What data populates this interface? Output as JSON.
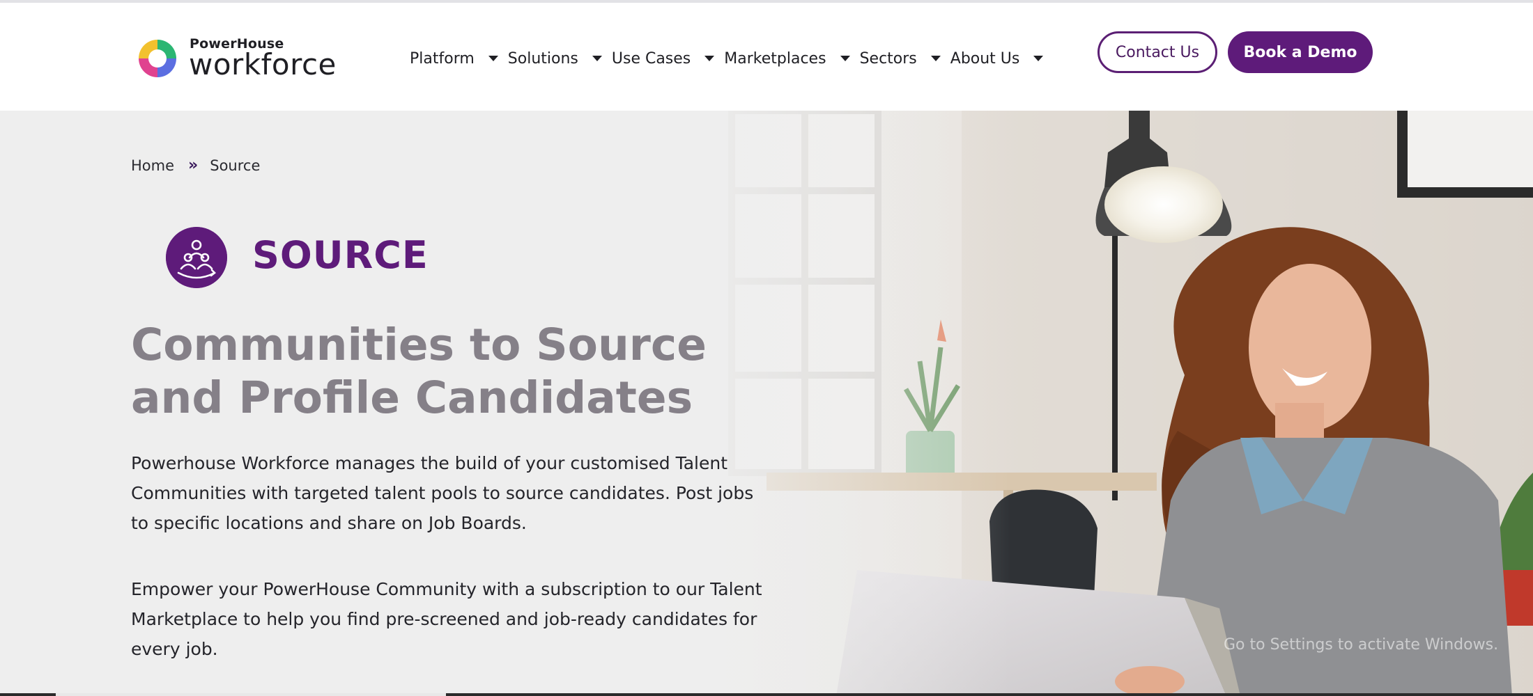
{
  "header": {
    "logo": {
      "small_text": "PowerHouse",
      "big_text": "workforce"
    },
    "nav": [
      {
        "label": "Platform",
        "icon": "caret-down-icon"
      },
      {
        "label": "Solutions",
        "icon": "caret-down-icon"
      },
      {
        "label": "Use Cases",
        "icon": "caret-down-icon"
      },
      {
        "label": "Marketplaces",
        "icon": "caret-down-icon"
      },
      {
        "label": "Sectors",
        "icon": "caret-down-icon"
      },
      {
        "label": "About Us",
        "icon": "caret-down-icon"
      }
    ],
    "contact_label": "Contact Us",
    "demo_label": "Book a Demo"
  },
  "breadcrumb": {
    "home": "Home",
    "separator": "»",
    "current": "Source"
  },
  "hero": {
    "section_label": "SOURCE",
    "section_icon": "community-people-icon",
    "heading": "Communities to Source and Profile Candidates",
    "paragraph_1": "Powerhouse Workforce manages the build of your customised Talent Communities with targeted talent pools to source candidates. Post jobs to specific locations and share on Job Boards.",
    "paragraph_2": "Empower your PowerHouse Community with a subscription to our Talent Marketplace to help you find pre-screened and job-ready candidates for every job.",
    "watermark": "Go to Settings to activate Windows."
  },
  "colors": {
    "brand_purple": "#5e1b7a",
    "heading_gray": "#858088",
    "text_dark": "#24242a"
  }
}
